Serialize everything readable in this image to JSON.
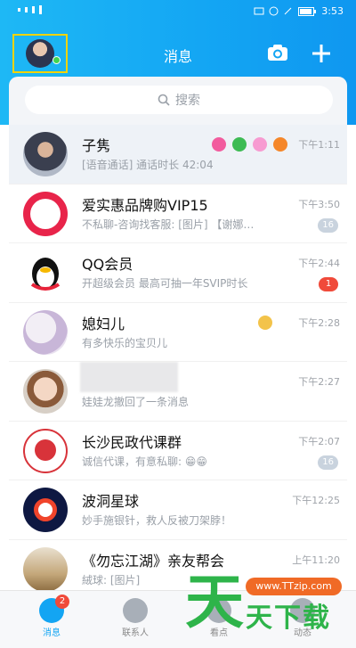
{
  "status": {
    "left": "…",
    "time": "3:53"
  },
  "header": {
    "title": "消息"
  },
  "search": {
    "placeholder": "搜索"
  },
  "conversations": [
    {
      "name": "子隽",
      "preview": "[语音通话] 通话时长 42:04",
      "time": "下午1:11",
      "badge": ""
    },
    {
      "name": "爱实惠品牌购VIP15",
      "preview": "不私聊-咨询找客服: [图片] 【谢娜…",
      "time": "下午3:50",
      "badge": "16"
    },
    {
      "name": "QQ会员",
      "preview": "开超级会员 最高可抽一年SVIP时长",
      "time": "下午2:44",
      "badge": "1"
    },
    {
      "name": "媳妇儿",
      "preview": "有多快乐的宝贝儿",
      "time": "下午2:28",
      "badge": ""
    },
    {
      "name": "",
      "preview": "娃娃龙撤回了一条消息",
      "time": "下午2:27",
      "badge": ""
    },
    {
      "name": "长沙民政代课群",
      "preview": "诚信代课，有意私聊: 😁😁",
      "time": "下午2:07",
      "badge": "16"
    },
    {
      "name": "波洞星球",
      "preview": "妙手施银针，救人反被刀架脖！",
      "time": "下午12:25",
      "badge": ""
    },
    {
      "name": "《勿忘江湖》亲友帮会",
      "preview": "絨球: [图片]",
      "time": "上午11:20",
      "badge": ""
    }
  ],
  "nav": {
    "messages": "消息",
    "messages_badge": "2",
    "contacts": "联系人",
    "watch": "看点",
    "dynamic": "动态"
  },
  "watermark": {
    "url": "www.TTzip.com",
    "text": "天下载",
    "big": "天"
  },
  "colors": {
    "accent": "#13a5f3",
    "badge_red": "#f04a3a",
    "badge_grey": "#c9d3de"
  }
}
